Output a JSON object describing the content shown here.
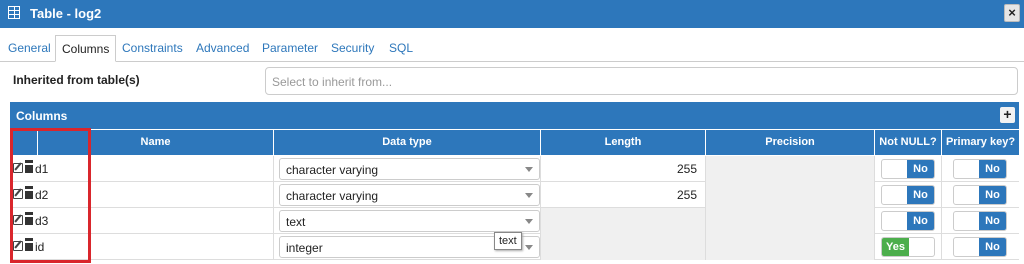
{
  "window": {
    "title": "Table - log2",
    "close_label": "×"
  },
  "tabs": [
    {
      "label": "General"
    },
    {
      "label": "Columns"
    },
    {
      "label": "Constraints"
    },
    {
      "label": "Advanced"
    },
    {
      "label": "Parameter"
    },
    {
      "label": "Security"
    },
    {
      "label": "SQL"
    }
  ],
  "active_tab": "Columns",
  "inherit": {
    "label": "Inherited from table(s)",
    "placeholder": "Select to inherit from..."
  },
  "columns_panel": {
    "title": "Columns",
    "add_label": "+",
    "headers": [
      "Name",
      "Data type",
      "Length",
      "Precision",
      "Not NULL?",
      "Primary key?"
    ],
    "rows": [
      {
        "name": "d1",
        "data_type": "character varying",
        "length": "255",
        "not_null": "No",
        "primary_key": "No"
      },
      {
        "name": "d2",
        "data_type": "character varying",
        "length": "255",
        "not_null": "No",
        "primary_key": "No"
      },
      {
        "name": "d3",
        "data_type": "text",
        "length": "",
        "not_null": "No",
        "primary_key": "No"
      },
      {
        "name": "id",
        "data_type": "integer",
        "length": "",
        "not_null": "Yes",
        "primary_key": "No"
      }
    ]
  },
  "tooltip": "text",
  "colors": {
    "accent": "#2d77bb",
    "yes": "#4cae4c",
    "highlight": "#d9262c"
  }
}
